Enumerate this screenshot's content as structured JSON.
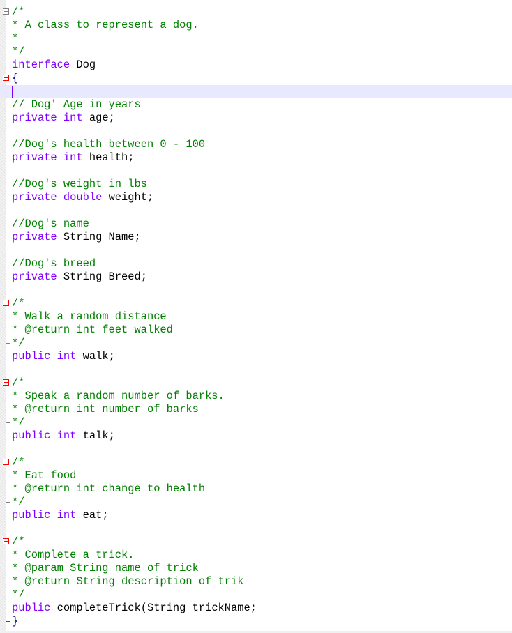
{
  "editor": {
    "language": "java",
    "colors": {
      "comment": "#008000",
      "keyword": "#8000ff",
      "text": "#000000",
      "brace": "#000080",
      "current_line": "#e8e8ff",
      "fold_active": "#ff0000",
      "fold_inactive": "#808080"
    },
    "lines": [
      {
        "fold": "start-gray",
        "segments": [
          {
            "cls": "c",
            "text": "/*"
          }
        ]
      },
      {
        "fold": "line-gray",
        "segments": [
          {
            "cls": "c",
            "text": "* A class to represent a dog."
          }
        ]
      },
      {
        "fold": "line-gray",
        "segments": [
          {
            "cls": "c",
            "text": "*"
          }
        ]
      },
      {
        "fold": "end-gray",
        "segments": [
          {
            "cls": "c",
            "text": "*/"
          }
        ]
      },
      {
        "fold": "",
        "segments": [
          {
            "cls": "k",
            "text": "interface"
          },
          {
            "cls": "t",
            "text": " Dog"
          }
        ]
      },
      {
        "fold": "start-red",
        "segments": [
          {
            "cls": "b",
            "text": "{"
          }
        ]
      },
      {
        "fold": "line-red",
        "current": true,
        "segments": []
      },
      {
        "fold": "line-red",
        "segments": [
          {
            "cls": "c",
            "text": "// Dog' Age in years"
          }
        ]
      },
      {
        "fold": "line-red",
        "segments": [
          {
            "cls": "k",
            "text": "private"
          },
          {
            "cls": "t",
            "text": " "
          },
          {
            "cls": "k",
            "text": "int"
          },
          {
            "cls": "t",
            "text": " age;"
          }
        ]
      },
      {
        "fold": "line-red",
        "segments": []
      },
      {
        "fold": "line-red",
        "segments": [
          {
            "cls": "c",
            "text": "//Dog's health between 0 - 100"
          }
        ]
      },
      {
        "fold": "line-red",
        "segments": [
          {
            "cls": "k",
            "text": "private"
          },
          {
            "cls": "t",
            "text": " "
          },
          {
            "cls": "k",
            "text": "int"
          },
          {
            "cls": "t",
            "text": " health;"
          }
        ]
      },
      {
        "fold": "line-red",
        "segments": []
      },
      {
        "fold": "line-red",
        "segments": [
          {
            "cls": "c",
            "text": "//Dog's weight in lbs"
          }
        ]
      },
      {
        "fold": "line-red",
        "segments": [
          {
            "cls": "k",
            "text": "private"
          },
          {
            "cls": "t",
            "text": " "
          },
          {
            "cls": "k",
            "text": "double"
          },
          {
            "cls": "t",
            "text": " weight;"
          }
        ]
      },
      {
        "fold": "line-red",
        "segments": []
      },
      {
        "fold": "line-red",
        "segments": [
          {
            "cls": "c",
            "text": "//Dog's name"
          }
        ]
      },
      {
        "fold": "line-red",
        "segments": [
          {
            "cls": "k",
            "text": "private"
          },
          {
            "cls": "t",
            "text": " String Name;"
          }
        ]
      },
      {
        "fold": "line-red",
        "segments": []
      },
      {
        "fold": "line-red",
        "segments": [
          {
            "cls": "c",
            "text": "//Dog's breed"
          }
        ]
      },
      {
        "fold": "line-red",
        "segments": [
          {
            "cls": "k",
            "text": "private"
          },
          {
            "cls": "t",
            "text": " String Breed;"
          }
        ]
      },
      {
        "fold": "line-red",
        "segments": []
      },
      {
        "fold": "sub-start",
        "segments": [
          {
            "cls": "c",
            "text": "/*"
          }
        ]
      },
      {
        "fold": "line-red",
        "segments": [
          {
            "cls": "c",
            "text": "* Walk a random distance"
          }
        ]
      },
      {
        "fold": "line-red",
        "segments": [
          {
            "cls": "c",
            "text": "* @return int feet walked"
          }
        ]
      },
      {
        "fold": "sub-end",
        "segments": [
          {
            "cls": "c",
            "text": "*/"
          }
        ]
      },
      {
        "fold": "line-red",
        "segments": [
          {
            "cls": "k",
            "text": "public"
          },
          {
            "cls": "t",
            "text": " "
          },
          {
            "cls": "k",
            "text": "int"
          },
          {
            "cls": "t",
            "text": " walk;"
          }
        ]
      },
      {
        "fold": "line-red",
        "segments": []
      },
      {
        "fold": "sub-start",
        "segments": [
          {
            "cls": "c",
            "text": "/*"
          }
        ]
      },
      {
        "fold": "line-red",
        "segments": [
          {
            "cls": "c",
            "text": "* Speak a random number of barks."
          }
        ]
      },
      {
        "fold": "line-red",
        "segments": [
          {
            "cls": "c",
            "text": "* @return int number of barks"
          }
        ]
      },
      {
        "fold": "sub-end",
        "segments": [
          {
            "cls": "c",
            "text": "*/"
          }
        ]
      },
      {
        "fold": "line-red",
        "segments": [
          {
            "cls": "k",
            "text": "public"
          },
          {
            "cls": "t",
            "text": " "
          },
          {
            "cls": "k",
            "text": "int"
          },
          {
            "cls": "t",
            "text": " talk;"
          }
        ]
      },
      {
        "fold": "line-red",
        "segments": []
      },
      {
        "fold": "sub-start",
        "segments": [
          {
            "cls": "c",
            "text": "/*"
          }
        ]
      },
      {
        "fold": "line-red",
        "segments": [
          {
            "cls": "c",
            "text": "* Eat food"
          }
        ]
      },
      {
        "fold": "line-red",
        "segments": [
          {
            "cls": "c",
            "text": "* @return int change to health"
          }
        ]
      },
      {
        "fold": "sub-end",
        "segments": [
          {
            "cls": "c",
            "text": "*/"
          }
        ]
      },
      {
        "fold": "line-red",
        "segments": [
          {
            "cls": "k",
            "text": "public"
          },
          {
            "cls": "t",
            "text": " "
          },
          {
            "cls": "k",
            "text": "int"
          },
          {
            "cls": "t",
            "text": " eat;"
          }
        ]
      },
      {
        "fold": "line-red",
        "segments": []
      },
      {
        "fold": "sub-start",
        "segments": [
          {
            "cls": "c",
            "text": "/*"
          }
        ]
      },
      {
        "fold": "line-red",
        "segments": [
          {
            "cls": "c",
            "text": "* Complete a trick."
          }
        ]
      },
      {
        "fold": "line-red",
        "segments": [
          {
            "cls": "c",
            "text": "* @param String name of trick"
          }
        ]
      },
      {
        "fold": "line-red",
        "segments": [
          {
            "cls": "c",
            "text": "* @return String description of trik"
          }
        ]
      },
      {
        "fold": "sub-end",
        "segments": [
          {
            "cls": "c",
            "text": "*/"
          }
        ]
      },
      {
        "fold": "line-red",
        "segments": [
          {
            "cls": "k",
            "text": "public"
          },
          {
            "cls": "t",
            "text": " completeTrick(String trickName;"
          }
        ]
      },
      {
        "fold": "end-red",
        "segments": [
          {
            "cls": "b",
            "text": "}"
          }
        ]
      }
    ]
  }
}
